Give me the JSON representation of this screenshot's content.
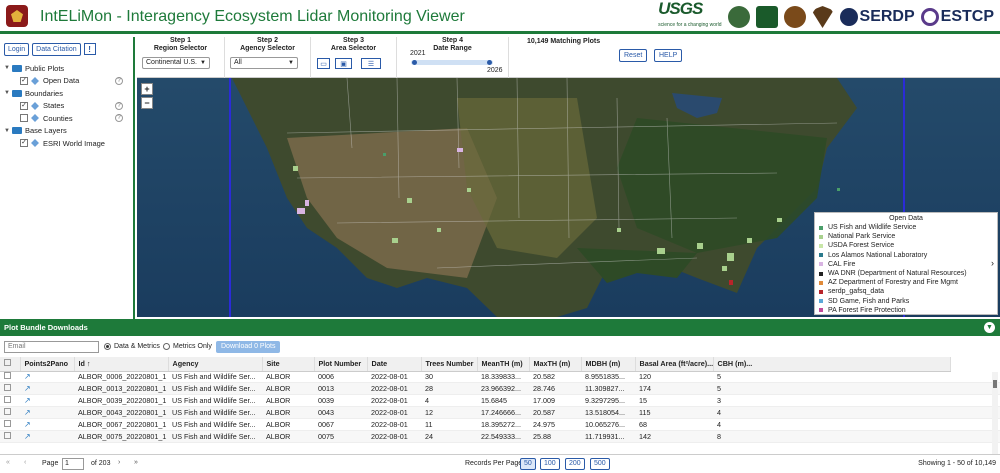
{
  "header": {
    "title": "IntELiMon - Interagency Ecosystem Lidar Monitoring Viewer",
    "usgs": "USGS",
    "usgs_tag": "science for a changing world",
    "serdp": "SERDP",
    "estcp": "ESTCP",
    "colors": {
      "brand_green": "#1e7a3a"
    }
  },
  "left": {
    "login": "Login",
    "citation": "Data Citation",
    "warn": "!",
    "tree": [
      {
        "label": "Public Plots",
        "level": 0,
        "type": "folder"
      },
      {
        "label": "Open Data",
        "level": 1,
        "type": "layer",
        "checked": true,
        "help": true
      },
      {
        "label": "Boundaries",
        "level": 0,
        "type": "folder"
      },
      {
        "label": "States",
        "level": 1,
        "type": "layer",
        "checked": true,
        "help": true
      },
      {
        "label": "Counties",
        "level": 1,
        "type": "layer",
        "checked": false,
        "help": true
      },
      {
        "label": "Base Layers",
        "level": 0,
        "type": "folder"
      },
      {
        "label": "ESRI World Image",
        "level": 1,
        "type": "layer",
        "checked": true,
        "help": false
      }
    ]
  },
  "steps": {
    "s1": {
      "t1": "Step 1",
      "t2": "Region Selector",
      "value": "Continental U.S."
    },
    "s2": {
      "t1": "Step 2",
      "t2": "Agency Selector",
      "value": "All"
    },
    "s3": {
      "t1": "Step 3",
      "t2": "Area Selector"
    },
    "s4": {
      "t1": "Step 4",
      "t2": "Date Range",
      "start": "2021",
      "end": "2026"
    },
    "matching": "10,149 Matching Plots",
    "reset": "Reset",
    "help": "HELP"
  },
  "map": {
    "zoom_in": "+",
    "zoom_out": "−"
  },
  "legend": {
    "title": "Open Data",
    "items": [
      {
        "label": "US Fish and Wildlife Service",
        "color": "#4a9e6a"
      },
      {
        "label": "National Park Service",
        "color": "#a8d08d"
      },
      {
        "label": "USDA Forest Service",
        "color": "#c8e6a8"
      },
      {
        "label": "Los Alamos National Laboratory",
        "color": "#2a7a8c"
      },
      {
        "label": "CAL Fire",
        "color": "#d8b4e2"
      },
      {
        "label": "WA DNR (Department of Natural Resources)",
        "color": "#222222"
      },
      {
        "label": "AZ Department of Forestry and Fire Mgmt",
        "color": "#e08a3a"
      },
      {
        "label": "serdp_gafsq_data",
        "color": "#b8242a"
      },
      {
        "label": "SD Game, Fish and Parks",
        "color": "#5aa8d8"
      },
      {
        "label": "PA Forest Fire Protection",
        "color": "#c04a9a"
      }
    ]
  },
  "bundle": {
    "title": "Plot Bundle Downloads",
    "email_placeholder": "Email",
    "opt1": "Data & Metrics",
    "opt2": "Metrics Only",
    "download": "Download 0 Plots"
  },
  "table": {
    "headers": [
      "Points2Pano",
      "Id ↑",
      "Agency",
      "Site",
      "Plot Number",
      "Date",
      "Trees Number",
      "MeanTH (m)",
      "MaxTH (m)",
      "MDBH (m)",
      "Basal Area (ft²/acre)...",
      "CBH (m)..."
    ],
    "rows": [
      [
        "ALBOR_0006_20220801_1",
        "US Fish and Wildlife Ser...",
        "ALBOR",
        "0006",
        "2022-08-01",
        "30",
        "18.339833...",
        "20.582",
        "8.9551835...",
        "120",
        "5"
      ],
      [
        "ALBOR_0013_20220801_1",
        "US Fish and Wildlife Ser...",
        "ALBOR",
        "0013",
        "2022-08-01",
        "28",
        "23.966392...",
        "28.746",
        "11.309827...",
        "174",
        "5"
      ],
      [
        "ALBOR_0039_20220801_1",
        "US Fish and Wildlife Ser...",
        "ALBOR",
        "0039",
        "2022-08-01",
        "4",
        "15.6845",
        "17.009",
        "9.3297295...",
        "15",
        "3"
      ],
      [
        "ALBOR_0043_20220801_1",
        "US Fish and Wildlife Ser...",
        "ALBOR",
        "0043",
        "2022-08-01",
        "12",
        "17.246666...",
        "20.587",
        "13.518054...",
        "115",
        "4"
      ],
      [
        "ALBOR_0067_20220801_1",
        "US Fish and Wildlife Ser...",
        "ALBOR",
        "0067",
        "2022-08-01",
        "11",
        "18.395272...",
        "24.975",
        "10.065276...",
        "68",
        "4"
      ],
      [
        "ALBOR_0075_20220801_1",
        "US Fish and Wildlife Ser...",
        "ALBOR",
        "0075",
        "2022-08-01",
        "24",
        "22.549333...",
        "25.88",
        "11.719931...",
        "142",
        "8"
      ]
    ]
  },
  "pager": {
    "page_label": "Page",
    "page": "1",
    "of": "of 203",
    "rpp_label": "Records Per Page:",
    "rpp": [
      "50",
      "100",
      "200",
      "500"
    ],
    "showing": "Showing 1 - 50 of 10,149"
  }
}
